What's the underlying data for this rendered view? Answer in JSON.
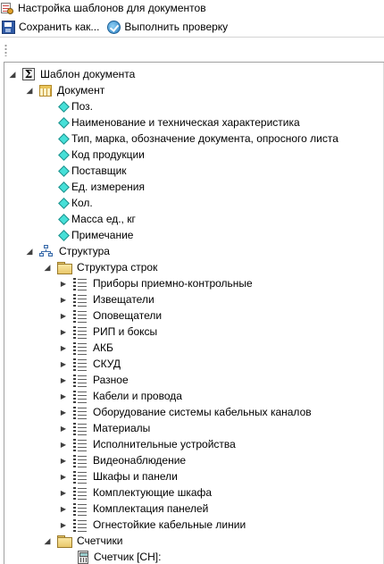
{
  "window": {
    "title": "Настройка шаблонов для документов",
    "icon": "template-settings-icon"
  },
  "toolbar": {
    "save_as": {
      "label": "Сохранить как...",
      "icon": "save-icon"
    },
    "check": {
      "label": "Выполнить проверку",
      "icon": "check-icon"
    }
  },
  "tree": {
    "root": {
      "label": "Шаблон документа",
      "icon": "sigma-icon",
      "expanded": true
    },
    "document": {
      "label": "Документ",
      "icon": "table-icon",
      "expanded": true,
      "fields": [
        "Поз.",
        "Наименование и техническая характеристика",
        "Тип, марка, обозначение документа, опросного листа",
        "Код продукции",
        "Поставщик",
        "Ед. измерения",
        "Кол.",
        "Масса ед., кг",
        "Примечание"
      ]
    },
    "structure": {
      "label": "Структура",
      "icon": "org-chart-icon",
      "expanded": true,
      "row_structure": {
        "label": "Структура строк",
        "icon": "folder-icon",
        "expanded": true,
        "items": [
          "Приборы приемно-контрольные",
          "Извещатели",
          "Оповещатели",
          "РИП и боксы",
          "АКБ",
          "СКУД",
          "Разное",
          "Кабели и провода",
          "Оборудование системы кабельных каналов",
          "Материалы",
          "Исполнительные устройства",
          "Видеонаблюдение",
          "Шкафы и панели",
          "Комплектующие шкафа",
          "Комплектация панелей",
          "Огнестойкие кабельные линии"
        ]
      },
      "counters": {
        "label": "Счетчики",
        "icon": "folder-icon",
        "expanded": true,
        "items": [
          "Счетчик [СН]:"
        ]
      }
    }
  }
}
